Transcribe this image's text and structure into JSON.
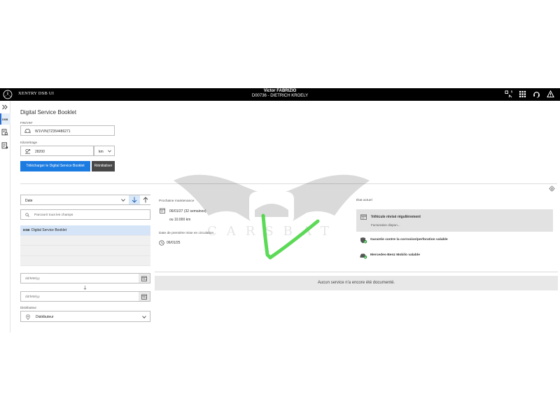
{
  "app": {
    "brand": "XENTRY DSB UI",
    "user_name": "Victor FABRIZIO",
    "user_org": "D00736 - DIETRICH KROELY",
    "icons": [
      "mercedes-star-icon",
      "qr-scan-icon",
      "apps-grid-icon",
      "headset-icon",
      "warning-icon"
    ]
  },
  "rail": {
    "active_label": "DSB"
  },
  "form": {
    "title": "Digital Service Booklet",
    "vin_label": "FIN/VIN*",
    "vin_value": "W1VVN(TZ354486271",
    "mileage_label": "Kilométrage",
    "mileage_value": "28200",
    "unit_value": "km",
    "download_label": "Télécharger le Digital Service Booklet",
    "reset_label": "Réinitialiser"
  },
  "filters": {
    "sort_value": "Date",
    "search_placeholder": "Parcourir tous les champs",
    "list_items": [
      {
        "tag": "DSB",
        "label": "Digital Service Booklet"
      }
    ],
    "date_from_placeholder": "dd/MM/yy",
    "date_to_placeholder": "dd/MM/yy",
    "distributor_label": "Distributeur",
    "distributor_value": "Distributeur"
  },
  "maintenance": {
    "next_label": "Prochaine maintenance",
    "next_date": "06/01/27 (32 semaines)",
    "next_km": "ou 10.000 km",
    "first_use_label": "Date de première mise en circulation",
    "first_use_date": "06/01/25"
  },
  "status": {
    "label": "État actuel",
    "card_title": "Véhicule révisé régulièrement",
    "card_subtitle": "Facturation dispon...",
    "items": [
      "Garantie contre la corrosion/perforation valable",
      "Mercedes-Benz Mobilo valable"
    ],
    "empty_message": "Aucun service n'a encore été documenté."
  },
  "watermark": {
    "text": "CARSBAT"
  },
  "colors": {
    "primary": "#1c7be0",
    "selected_row": "#d5e5f7",
    "status_green": "#2e9e3e",
    "topbar": "#000000"
  }
}
